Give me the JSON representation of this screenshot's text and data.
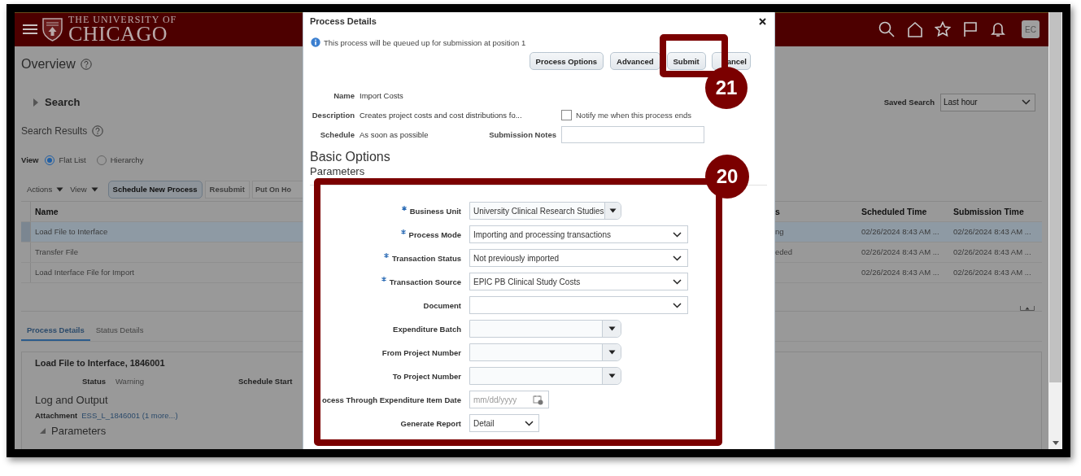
{
  "header": {
    "logo_line_1": "THE UNIVERSITY OF",
    "logo_line_2": "CHICAGO",
    "avatar": "EC"
  },
  "page": {
    "title": "Overview",
    "search_label": "Search",
    "search_expanded": false,
    "saved_search": {
      "label": "Saved Search",
      "value": "Last hour"
    },
    "results_title": "Search Results",
    "view": {
      "label": "View",
      "options": [
        {
          "label": "Flat List",
          "selected": true
        },
        {
          "label": "Hierarchy",
          "selected": false
        }
      ]
    },
    "toolbar": {
      "menus": [
        "Actions",
        "View"
      ],
      "buttons": [
        {
          "label": "Schedule New Process",
          "disabled": false
        },
        {
          "label": "Resubmit",
          "disabled": true
        },
        {
          "label": "Put On Ho",
          "disabled": true
        }
      ]
    },
    "table": {
      "columns": [
        "Name",
        "s",
        "Scheduled Time",
        "Submission Time"
      ],
      "rows": [
        {
          "name": "Load File to Interface",
          "column_2": "ng",
          "scheduled_time": "02/26/2024 8:43 AM ...",
          "submission_time": "02/26/2024 8:43 AM ...",
          "selected": true
        },
        {
          "name": "Transfer File",
          "column_2": "eded",
          "scheduled_time": "02/26/2024 8:43 AM ...",
          "submission_time": "02/26/2024 8:43 AM ...",
          "selected": false
        },
        {
          "name": "Load Interface File for Import",
          "scheduled_time": "02/26/2024 8:43 AM ...",
          "submission_time": "02/26/2024 8:43 AM ...",
          "selected": false
        }
      ]
    },
    "detail_tabs": [
      {
        "label": "Process Details",
        "selected": true
      },
      {
        "label": "Status Details",
        "selected": false
      }
    ],
    "detail": {
      "title": "Load File to Interface, 1846001",
      "status_label": "Status",
      "status": "Warning",
      "schedule_start_label": "Schedule Start",
      "log_heading": "Log and Output",
      "attachment_label": "Attachment",
      "attachment": "ESS_L_1846001 (1 more...)",
      "parameters": "Parameters",
      "parameters_expanded": true
    }
  },
  "dialog": {
    "title": "Process Details",
    "info": "This process will be queued up for submission at position 1",
    "buttons": [
      "Process Options",
      "Advanced",
      "Submit",
      "ancel"
    ],
    "name": {
      "label": "Name",
      "value": "Import Costs"
    },
    "description": {
      "label": "Description",
      "value": "Creates project costs and cost distributions fo..."
    },
    "schedule": {
      "label": "Schedule",
      "value": "As soon as possible"
    },
    "notify": {
      "label": "Notify me when this process ends",
      "checked": false
    },
    "submission_notes": {
      "label": "Submission Notes"
    },
    "section": "Basic Options",
    "subsection": "Parameters",
    "parameters": [
      {
        "label": "Business Unit",
        "required": true,
        "kind": "combo",
        "value": "University Clinical Research Studies"
      },
      {
        "label": "Process Mode",
        "required": true,
        "kind": "select",
        "value": "Importing and processing transactions"
      },
      {
        "label": "Transaction Status",
        "required": true,
        "kind": "select",
        "value": "Not previously imported"
      },
      {
        "label": "Transaction Source",
        "required": true,
        "kind": "select",
        "value": "EPIC PB Clinical Study Costs"
      },
      {
        "label": "Document",
        "required": false,
        "kind": "select"
      },
      {
        "label": "Expenditure Batch",
        "required": false,
        "kind": "combo"
      },
      {
        "label": "From Project Number",
        "required": false,
        "kind": "combo"
      },
      {
        "label": "To Project Number",
        "required": false,
        "kind": "combo"
      },
      {
        "label": "ocess Through Expenditure Item Date",
        "kind": "date",
        "placeholder": "mm/dd/yyyy"
      },
      {
        "label": "Generate Report",
        "required": false,
        "kind": "choice",
        "value": "Detail"
      }
    ]
  },
  "callouts": [
    {
      "number": "21"
    },
    {
      "number": "20"
    }
  ]
}
